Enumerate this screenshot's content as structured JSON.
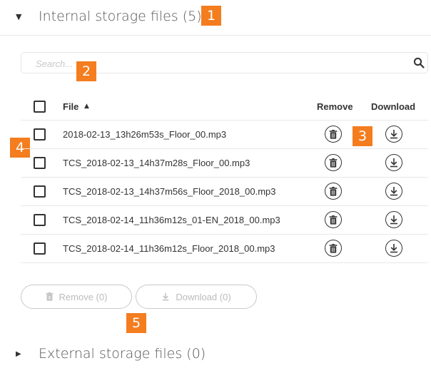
{
  "internal_section": {
    "caret": "▼",
    "title": "Internal storage files (5)",
    "badge": "1"
  },
  "search": {
    "placeholder": "Search...",
    "value": "",
    "badge": "2",
    "icon": "search-icon"
  },
  "table": {
    "columns": {
      "file": "File",
      "sort_indicator": "▲",
      "remove": "Remove",
      "download": "Download"
    },
    "remove_badge": "3",
    "checkbox_badge": "4",
    "rows": [
      {
        "filename": "2018-02-13_13h26m53s_Floor_00.mp3",
        "checked": false
      },
      {
        "filename": "TCS_2018-02-13_14h37m28s_Floor_00.mp3",
        "checked": false
      },
      {
        "filename": "TCS_2018-02-13_14h37m56s_Floor_2018_00.mp3",
        "checked": false
      },
      {
        "filename": "TCS_2018-02-14_11h36m12s_01-EN_2018_00.mp3",
        "checked": false
      },
      {
        "filename": "TCS_2018-02-14_11h36m12s_Floor_2018_00.mp3",
        "checked": false
      }
    ]
  },
  "actions": {
    "remove_label": "Remove (0)",
    "download_label": "Download (0)",
    "badge": "5"
  },
  "external_section": {
    "caret": "▶",
    "title": "External storage files (0)"
  },
  "colors": {
    "badge_bg": "#f47d1f",
    "text": "#333333",
    "disabled": "#bbbbbb",
    "border": "#e8e8e8"
  }
}
